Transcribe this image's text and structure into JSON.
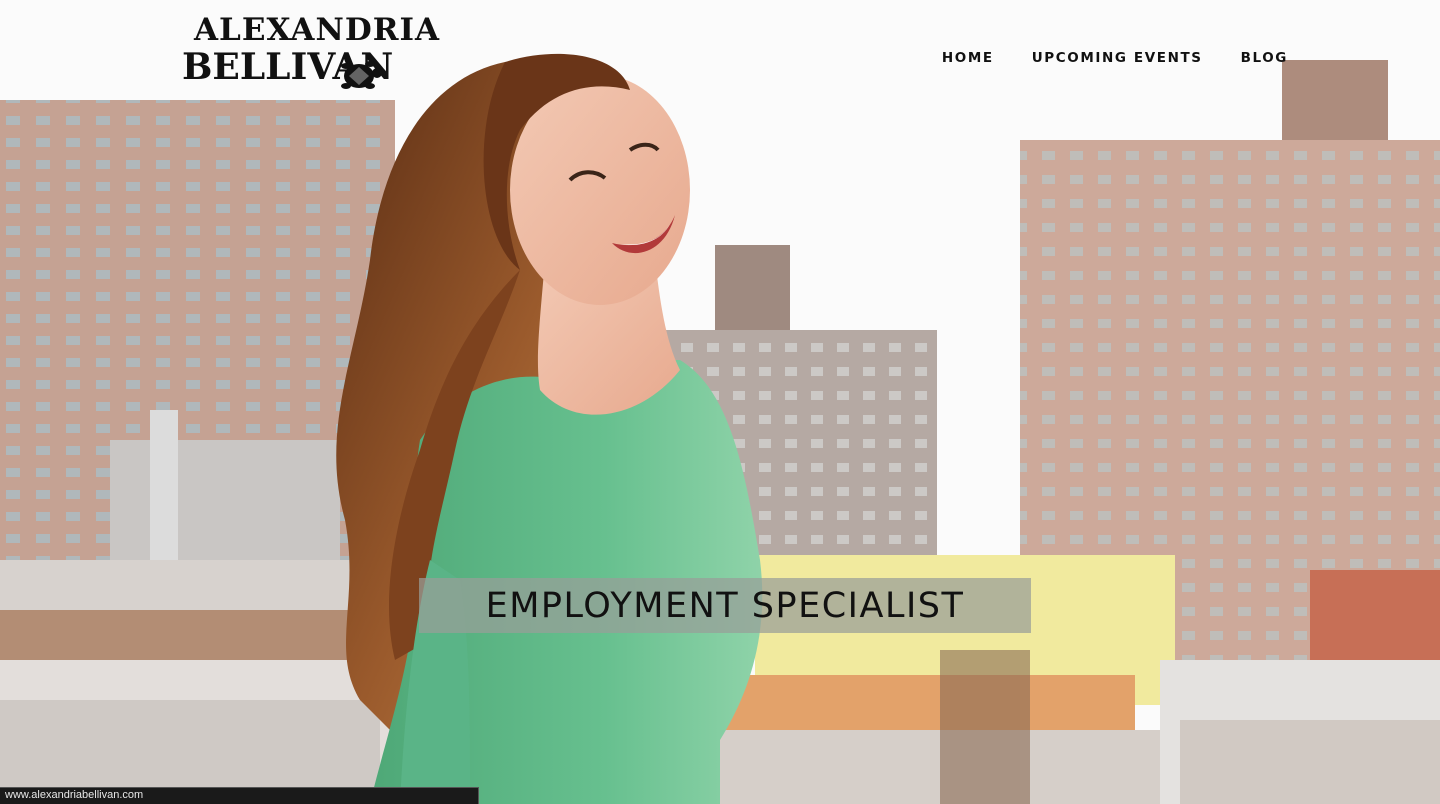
{
  "logo": {
    "line1": "ALEXANDRIA",
    "line2": "BELLIVAN",
    "icon": "turtle-icon"
  },
  "nav": {
    "items": [
      {
        "label": "HOME"
      },
      {
        "label": "UPCOMING EVENTS"
      },
      {
        "label": "BLOG"
      }
    ]
  },
  "hero": {
    "banner_text": "EMPLOYMENT SPECIALIST",
    "photo": "woman-green-top-cityscape"
  },
  "statusbar": {
    "url": "www.alexandriabellivan.com"
  },
  "colors": {
    "text": "#111111",
    "banner_bg": "#989e98",
    "shirt": "#5fb98a",
    "hair": "#8a4a22",
    "brick": "#b88f7a"
  }
}
